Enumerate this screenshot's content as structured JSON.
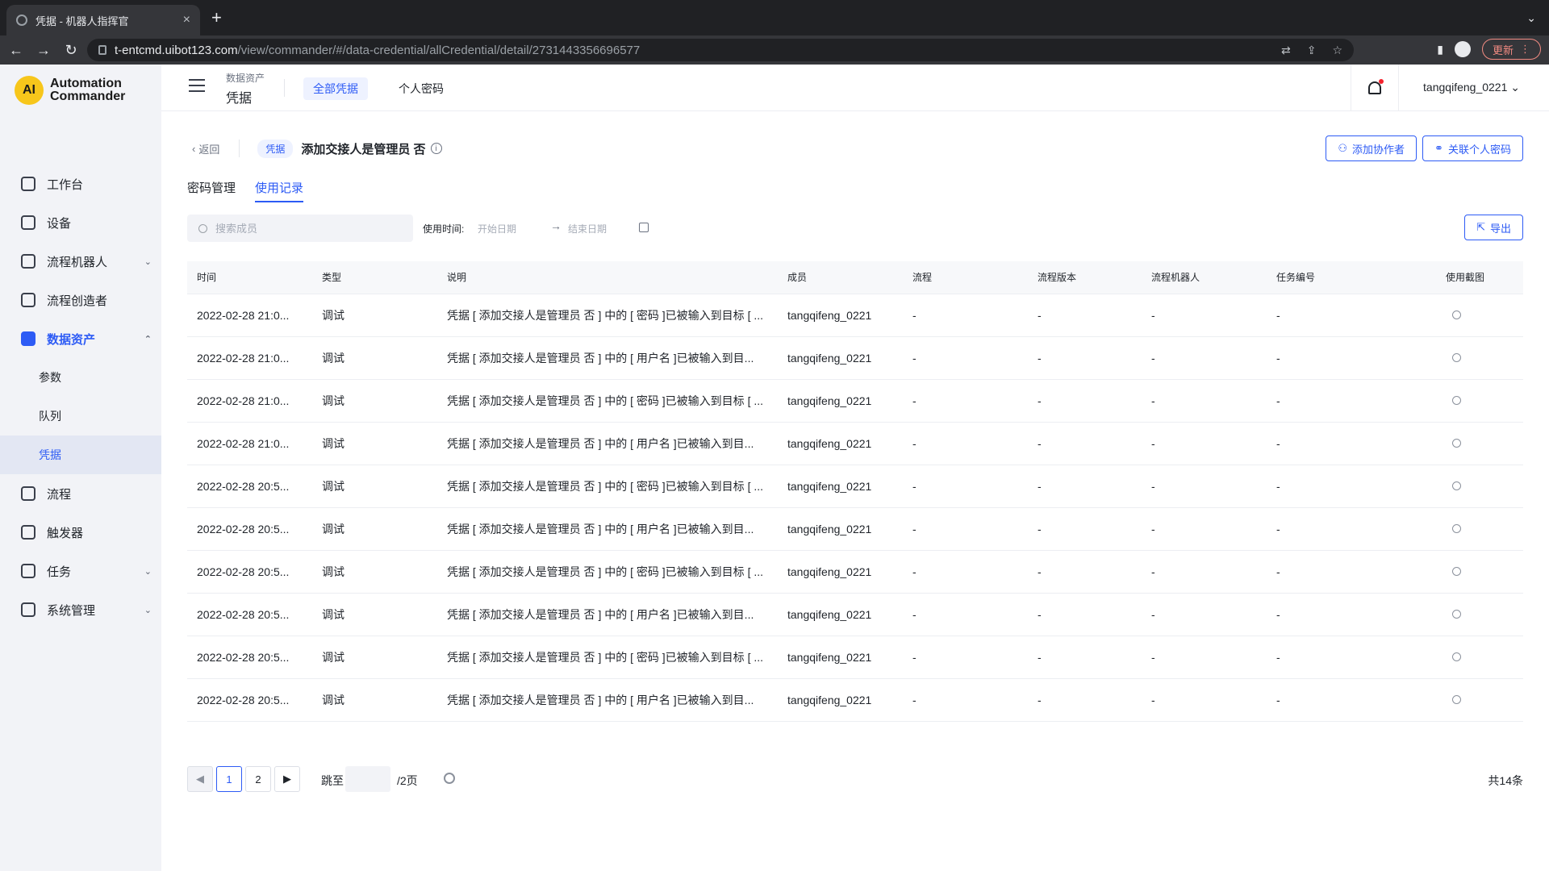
{
  "browser": {
    "tab_title": "凭据 - 机器人指挥官",
    "url_host": "t-entcmd.uibot123.com",
    "url_path": "/view/commander/#/data-credential/allCredential/detail/2731443356696577",
    "update_label": "更新"
  },
  "logo": {
    "line1": "Automation",
    "line2": "Commander",
    "mark": "AI"
  },
  "sidebar": {
    "items": [
      {
        "label": "工作台",
        "icon": "workbench-icon"
      },
      {
        "label": "设备",
        "icon": "device-icon"
      },
      {
        "label": "流程机器人",
        "icon": "robot-icon"
      },
      {
        "label": "流程创造者",
        "icon": "creator-icon"
      },
      {
        "label": "数据资产",
        "icon": "folder-icon"
      },
      {
        "label": "流程",
        "icon": "flow-icon"
      },
      {
        "label": "触发器",
        "icon": "trigger-icon"
      },
      {
        "label": "任务",
        "icon": "task-icon"
      },
      {
        "label": "系统管理",
        "icon": "system-icon"
      }
    ],
    "subitems": [
      "参数",
      "队列",
      "凭据"
    ]
  },
  "header": {
    "crumb_top": "数据资产",
    "crumb_main": "凭据",
    "tabs": [
      "全部凭据",
      "个人密码"
    ],
    "username": "tangqifeng_0221"
  },
  "detail": {
    "back": "返回",
    "tag": "凭据",
    "title": "添加交接人是管理员 否",
    "btn_add_collab": "添加协作者",
    "btn_link_pwd": "关联个人密码"
  },
  "subtabs": [
    "密码管理",
    "使用记录"
  ],
  "filters": {
    "search_placeholder": "搜索成员",
    "time_label": "使用时间:",
    "start_placeholder": "开始日期",
    "end_placeholder": "结束日期",
    "export_label": "导出"
  },
  "table": {
    "columns": [
      "时间",
      "类型",
      "说明",
      "成员",
      "流程",
      "流程版本",
      "流程机器人",
      "任务编号",
      "使用截图"
    ],
    "rows": [
      [
        "2022-02-28 21:0...",
        "调试",
        "凭据 [ 添加交接人是管理员 否 ] 中的 [ 密码 ]已被输入到目标 [ ...",
        "tangqifeng_0221",
        "-",
        "-",
        "-",
        "-"
      ],
      [
        "2022-02-28 21:0...",
        "调试",
        "凭据 [ 添加交接人是管理员 否 ] 中的 [ 用户名 ]已被输入到目...",
        "tangqifeng_0221",
        "-",
        "-",
        "-",
        "-"
      ],
      [
        "2022-02-28 21:0...",
        "调试",
        "凭据 [ 添加交接人是管理员 否 ] 中的 [ 密码 ]已被输入到目标 [ ...",
        "tangqifeng_0221",
        "-",
        "-",
        "-",
        "-"
      ],
      [
        "2022-02-28 21:0...",
        "调试",
        "凭据 [ 添加交接人是管理员 否 ] 中的 [ 用户名 ]已被输入到目...",
        "tangqifeng_0221",
        "-",
        "-",
        "-",
        "-"
      ],
      [
        "2022-02-28 20:5...",
        "调试",
        "凭据 [ 添加交接人是管理员 否 ] 中的 [ 密码 ]已被输入到目标 [ ...",
        "tangqifeng_0221",
        "-",
        "-",
        "-",
        "-"
      ],
      [
        "2022-02-28 20:5...",
        "调试",
        "凭据 [ 添加交接人是管理员 否 ] 中的 [ 用户名 ]已被输入到目...",
        "tangqifeng_0221",
        "-",
        "-",
        "-",
        "-"
      ],
      [
        "2022-02-28 20:5...",
        "调试",
        "凭据 [ 添加交接人是管理员 否 ] 中的 [ 密码 ]已被输入到目标 [ ...",
        "tangqifeng_0221",
        "-",
        "-",
        "-",
        "-"
      ],
      [
        "2022-02-28 20:5...",
        "调试",
        "凭据 [ 添加交接人是管理员 否 ] 中的 [ 用户名 ]已被输入到目...",
        "tangqifeng_0221",
        "-",
        "-",
        "-",
        "-"
      ],
      [
        "2022-02-28 20:5...",
        "调试",
        "凭据 [ 添加交接人是管理员 否 ] 中的 [ 密码 ]已被输入到目标 [ ...",
        "tangqifeng_0221",
        "-",
        "-",
        "-",
        "-"
      ],
      [
        "2022-02-28 20:5...",
        "调试",
        "凭据 [ 添加交接人是管理员 否 ] 中的 [ 用户名 ]已被输入到目...",
        "tangqifeng_0221",
        "-",
        "-",
        "-",
        "-"
      ]
    ]
  },
  "pagination": {
    "pages": [
      "1",
      "2"
    ],
    "current": "1",
    "jump_label": "跳至",
    "page_total": "/2页",
    "total": "共14条"
  },
  "colors": {
    "accent": "#2d5bf5",
    "sidebar_bg": "#f2f3f7"
  }
}
